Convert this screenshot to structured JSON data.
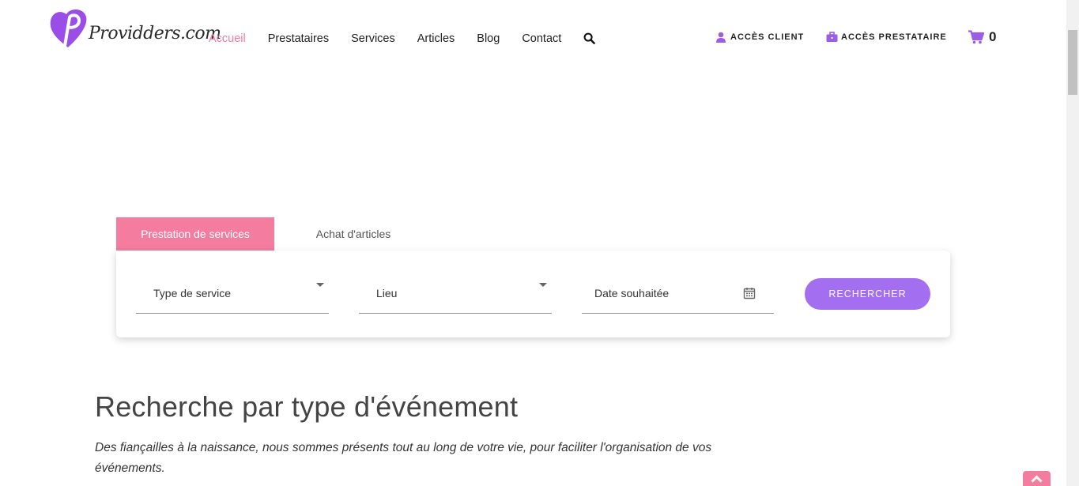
{
  "logo": {
    "text": "Providders.com"
  },
  "nav": {
    "items": [
      {
        "label": "Accueil",
        "active": true
      },
      {
        "label": "Prestataires",
        "active": false
      },
      {
        "label": "Services",
        "active": false
      },
      {
        "label": "Articles",
        "active": false
      },
      {
        "label": "Blog",
        "active": false
      },
      {
        "label": "Contact",
        "active": false
      }
    ],
    "search_icon": "search-icon"
  },
  "access": {
    "client_label": "ACCÈS CLIENT",
    "provider_label": "ACCÈS PRESTATAIRE"
  },
  "cart": {
    "count": "0",
    "icon": "cart-icon"
  },
  "search": {
    "tabs": [
      {
        "label": "Prestation de services",
        "active": true
      },
      {
        "label": "Achat d'articles",
        "active": false
      }
    ],
    "fields": {
      "service_type": "Type de service",
      "location": "Lieu",
      "date": "Date souhaitée"
    },
    "button_label": "RECHERCHER"
  },
  "events": {
    "title": "Recherche par type d'événement",
    "description": "Des fiançailles à la naissance, nous sommes présents tout au long de votre vie, pour faciliter l'organisation de vos événements."
  },
  "colors": {
    "accent_pink": "#f47c9e",
    "accent_purple": "#a36ff0"
  }
}
